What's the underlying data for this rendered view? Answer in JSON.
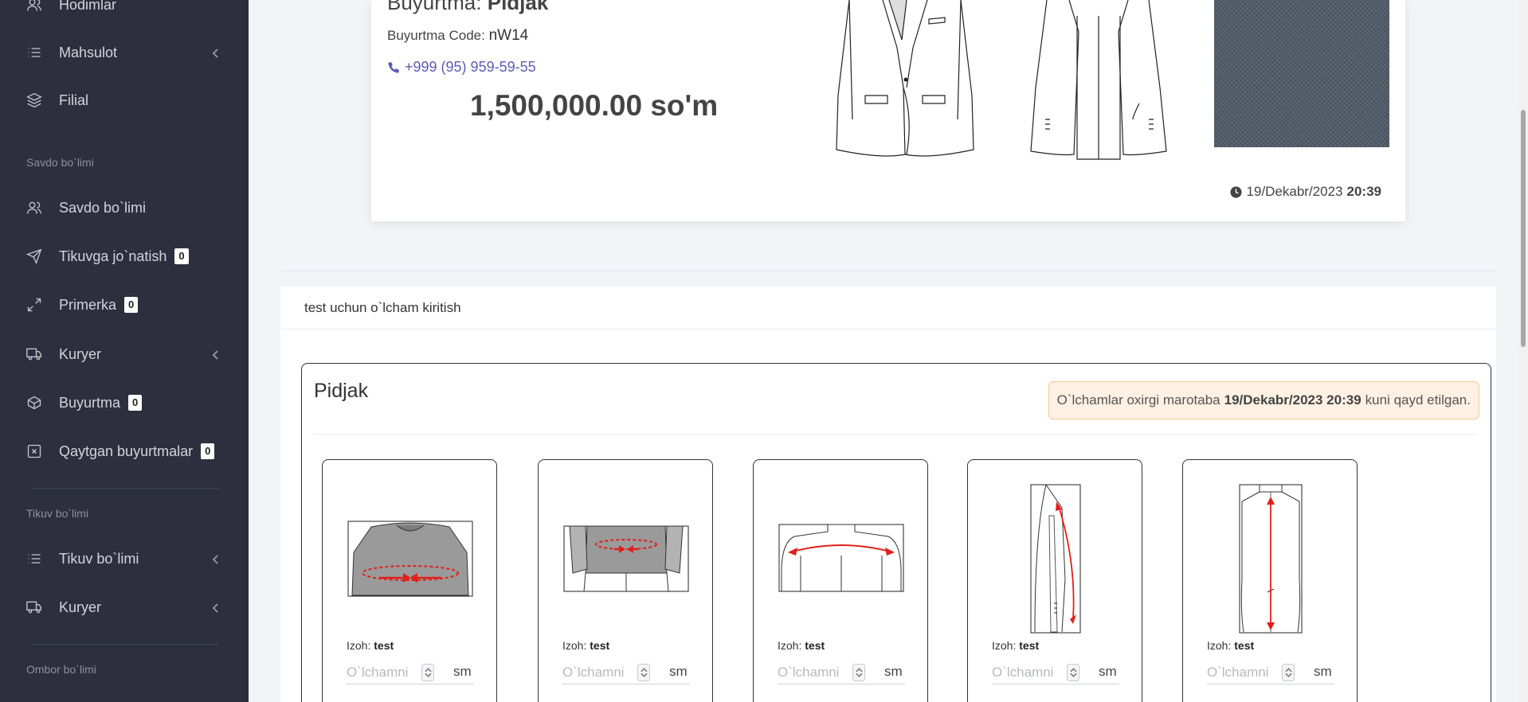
{
  "sidebar": {
    "items_top": [
      {
        "label": "Hodimlar",
        "icon": "users-icon"
      },
      {
        "label": "Mahsulot",
        "icon": "list-icon",
        "chevron": true
      },
      {
        "label": "Filial",
        "icon": "layers-icon"
      }
    ],
    "section_savdo": "Savdo bo`limi",
    "items_savdo": [
      {
        "label": "Savdo bo`limi",
        "icon": "users-icon"
      },
      {
        "label": "Tikuvga jo`natish",
        "icon": "send-icon",
        "badge": "0"
      },
      {
        "label": "Primerka",
        "icon": "expand-icon",
        "badge": "0"
      },
      {
        "label": "Kuryer",
        "icon": "truck-icon",
        "chevron": true
      },
      {
        "label": "Buyurtma",
        "icon": "box-icon",
        "badge": "0"
      },
      {
        "label": "Qaytgan buyurtmalar",
        "icon": "x-square-icon",
        "badge": "0"
      }
    ],
    "section_tikuv": "Tikuv bo`limi",
    "items_tikuv": [
      {
        "label": "Tikuv bo`limi",
        "icon": "list-icon",
        "chevron": true
      },
      {
        "label": "Kuryer",
        "icon": "truck-icon",
        "chevron": true
      }
    ],
    "section_ombor": "Ombor bo`limi"
  },
  "order": {
    "title_prefix": "Buyurtma:",
    "title_value": "Pidjak",
    "code_label": "Buyurtma Code:",
    "code_value": "nW14",
    "phone": "+999 (95) 959-59-55",
    "price": "1,500,000.00 so'm",
    "date": "19/Dekabr/2023",
    "time": "20:39"
  },
  "measure": {
    "panel_title": "test uchun o`lcham kiritish",
    "product_title": "Pidjak",
    "note_prefix": "O`lchamlar oxirgi marotaba",
    "note_date": "19/Dekabr/2023 20:39",
    "note_suffix": "kuni qayd etilgan.",
    "cards": [
      {
        "izoh_label": "Izoh:",
        "izoh_value": "test",
        "placeholder": "O`lchamni kiriting",
        "unit": "sm"
      },
      {
        "izoh_label": "Izoh:",
        "izoh_value": "test",
        "placeholder": "O`lchamni kiriting",
        "unit": "sm"
      },
      {
        "izoh_label": "Izoh:",
        "izoh_value": "test",
        "placeholder": "O`lchamni kiriting",
        "unit": "sm"
      },
      {
        "izoh_label": "Izoh:",
        "izoh_value": "test",
        "placeholder": "O`lchamni kiriting",
        "unit": "sm"
      },
      {
        "izoh_label": "Izoh:",
        "izoh_value": "test",
        "placeholder": "O`lchamni kiriting",
        "unit": "sm"
      }
    ]
  },
  "colors": {
    "sidebar_bg": "#2d2f3e",
    "accent_link": "#5e5ab6",
    "arrow_red": "#e0201b",
    "note_bg": "#fdf1e3"
  }
}
